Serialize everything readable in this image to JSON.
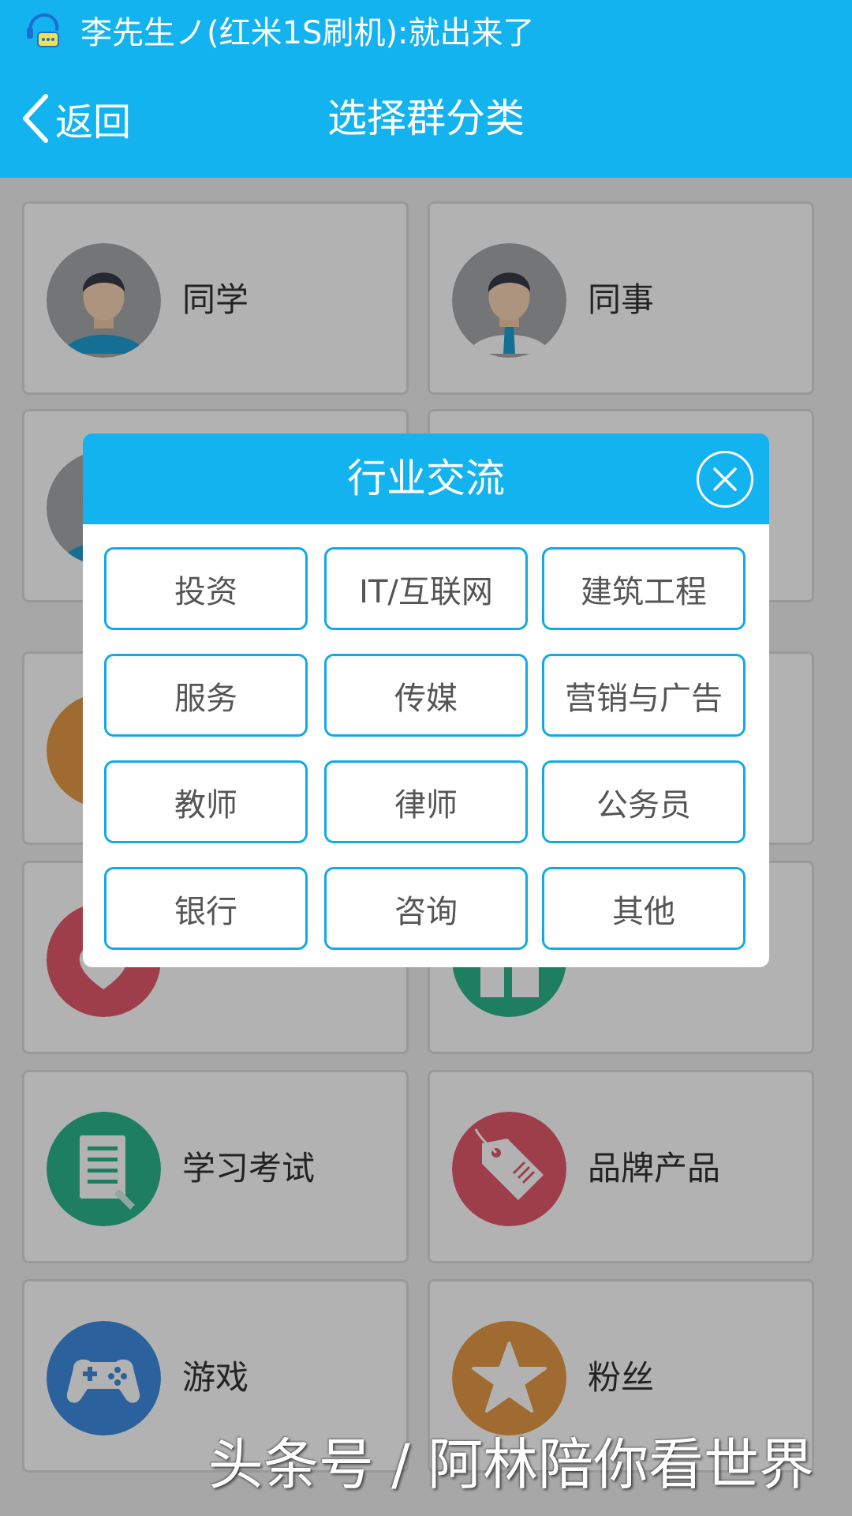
{
  "notification": {
    "text": "李先生ノ(红米1S刷机):就出来了",
    "icon": "qq-chat-icon"
  },
  "nav": {
    "back_label": "返回",
    "title": "选择群分类"
  },
  "categories": [
    {
      "label": "同学",
      "icon": "student-avatar-icon",
      "color": "#a7a8aa"
    },
    {
      "label": "同事",
      "icon": "colleague-avatar-icon",
      "color": "#a7a8aa"
    },
    {
      "label": "",
      "icon": "avatar-icon",
      "color": "#a7a8aa"
    },
    {
      "label": "",
      "icon": "",
      "color": "#ffffff"
    },
    {
      "label": "",
      "icon": "orange-icon",
      "color": "#e69a45"
    },
    {
      "label": "",
      "icon": "",
      "color": "#ffffff"
    },
    {
      "label": "",
      "icon": "heart-icon",
      "color": "#e25a6b"
    },
    {
      "label": "",
      "icon": "building-icon",
      "color": "#2bb78a"
    },
    {
      "label": "学习考试",
      "icon": "document-icon",
      "color": "#2bb78a"
    },
    {
      "label": "品牌产品",
      "icon": "tag-icon",
      "color": "#e25a6b"
    },
    {
      "label": "游戏",
      "icon": "gamepad-icon",
      "color": "#3e8be0"
    },
    {
      "label": "粉丝",
      "icon": "star-icon",
      "color": "#e69a45"
    }
  ],
  "dialog": {
    "title": "行业交流",
    "options": [
      "投资",
      "IT/互联网",
      "建筑工程",
      "服务",
      "传媒",
      "营销与广告",
      "教师",
      "律师",
      "公务员",
      "银行",
      "咨询",
      "其他"
    ]
  },
  "watermark": "头条号 / 阿林陪你看世界",
  "colors": {
    "accent": "#13b3f0",
    "border": "#13a9e6"
  }
}
